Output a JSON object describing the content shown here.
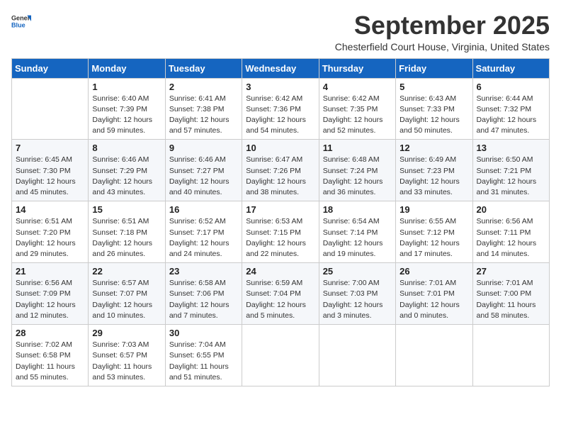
{
  "logo": {
    "general": "General",
    "blue": "Blue"
  },
  "title": "September 2025",
  "location": "Chesterfield Court House, Virginia, United States",
  "weekdays": [
    "Sunday",
    "Monday",
    "Tuesday",
    "Wednesday",
    "Thursday",
    "Friday",
    "Saturday"
  ],
  "weeks": [
    [
      {
        "day": "",
        "info": ""
      },
      {
        "day": "1",
        "info": "Sunrise: 6:40 AM\nSunset: 7:39 PM\nDaylight: 12 hours\nand 59 minutes."
      },
      {
        "day": "2",
        "info": "Sunrise: 6:41 AM\nSunset: 7:38 PM\nDaylight: 12 hours\nand 57 minutes."
      },
      {
        "day": "3",
        "info": "Sunrise: 6:42 AM\nSunset: 7:36 PM\nDaylight: 12 hours\nand 54 minutes."
      },
      {
        "day": "4",
        "info": "Sunrise: 6:42 AM\nSunset: 7:35 PM\nDaylight: 12 hours\nand 52 minutes."
      },
      {
        "day": "5",
        "info": "Sunrise: 6:43 AM\nSunset: 7:33 PM\nDaylight: 12 hours\nand 50 minutes."
      },
      {
        "day": "6",
        "info": "Sunrise: 6:44 AM\nSunset: 7:32 PM\nDaylight: 12 hours\nand 47 minutes."
      }
    ],
    [
      {
        "day": "7",
        "info": "Sunrise: 6:45 AM\nSunset: 7:30 PM\nDaylight: 12 hours\nand 45 minutes."
      },
      {
        "day": "8",
        "info": "Sunrise: 6:46 AM\nSunset: 7:29 PM\nDaylight: 12 hours\nand 43 minutes."
      },
      {
        "day": "9",
        "info": "Sunrise: 6:46 AM\nSunset: 7:27 PM\nDaylight: 12 hours\nand 40 minutes."
      },
      {
        "day": "10",
        "info": "Sunrise: 6:47 AM\nSunset: 7:26 PM\nDaylight: 12 hours\nand 38 minutes."
      },
      {
        "day": "11",
        "info": "Sunrise: 6:48 AM\nSunset: 7:24 PM\nDaylight: 12 hours\nand 36 minutes."
      },
      {
        "day": "12",
        "info": "Sunrise: 6:49 AM\nSunset: 7:23 PM\nDaylight: 12 hours\nand 33 minutes."
      },
      {
        "day": "13",
        "info": "Sunrise: 6:50 AM\nSunset: 7:21 PM\nDaylight: 12 hours\nand 31 minutes."
      }
    ],
    [
      {
        "day": "14",
        "info": "Sunrise: 6:51 AM\nSunset: 7:20 PM\nDaylight: 12 hours\nand 29 minutes."
      },
      {
        "day": "15",
        "info": "Sunrise: 6:51 AM\nSunset: 7:18 PM\nDaylight: 12 hours\nand 26 minutes."
      },
      {
        "day": "16",
        "info": "Sunrise: 6:52 AM\nSunset: 7:17 PM\nDaylight: 12 hours\nand 24 minutes."
      },
      {
        "day": "17",
        "info": "Sunrise: 6:53 AM\nSunset: 7:15 PM\nDaylight: 12 hours\nand 22 minutes."
      },
      {
        "day": "18",
        "info": "Sunrise: 6:54 AM\nSunset: 7:14 PM\nDaylight: 12 hours\nand 19 minutes."
      },
      {
        "day": "19",
        "info": "Sunrise: 6:55 AM\nSunset: 7:12 PM\nDaylight: 12 hours\nand 17 minutes."
      },
      {
        "day": "20",
        "info": "Sunrise: 6:56 AM\nSunset: 7:11 PM\nDaylight: 12 hours\nand 14 minutes."
      }
    ],
    [
      {
        "day": "21",
        "info": "Sunrise: 6:56 AM\nSunset: 7:09 PM\nDaylight: 12 hours\nand 12 minutes."
      },
      {
        "day": "22",
        "info": "Sunrise: 6:57 AM\nSunset: 7:07 PM\nDaylight: 12 hours\nand 10 minutes."
      },
      {
        "day": "23",
        "info": "Sunrise: 6:58 AM\nSunset: 7:06 PM\nDaylight: 12 hours\nand 7 minutes."
      },
      {
        "day": "24",
        "info": "Sunrise: 6:59 AM\nSunset: 7:04 PM\nDaylight: 12 hours\nand 5 minutes."
      },
      {
        "day": "25",
        "info": "Sunrise: 7:00 AM\nSunset: 7:03 PM\nDaylight: 12 hours\nand 3 minutes."
      },
      {
        "day": "26",
        "info": "Sunrise: 7:01 AM\nSunset: 7:01 PM\nDaylight: 12 hours\nand 0 minutes."
      },
      {
        "day": "27",
        "info": "Sunrise: 7:01 AM\nSunset: 7:00 PM\nDaylight: 11 hours\nand 58 minutes."
      }
    ],
    [
      {
        "day": "28",
        "info": "Sunrise: 7:02 AM\nSunset: 6:58 PM\nDaylight: 11 hours\nand 55 minutes."
      },
      {
        "day": "29",
        "info": "Sunrise: 7:03 AM\nSunset: 6:57 PM\nDaylight: 11 hours\nand 53 minutes."
      },
      {
        "day": "30",
        "info": "Sunrise: 7:04 AM\nSunset: 6:55 PM\nDaylight: 11 hours\nand 51 minutes."
      },
      {
        "day": "",
        "info": ""
      },
      {
        "day": "",
        "info": ""
      },
      {
        "day": "",
        "info": ""
      },
      {
        "day": "",
        "info": ""
      }
    ]
  ]
}
